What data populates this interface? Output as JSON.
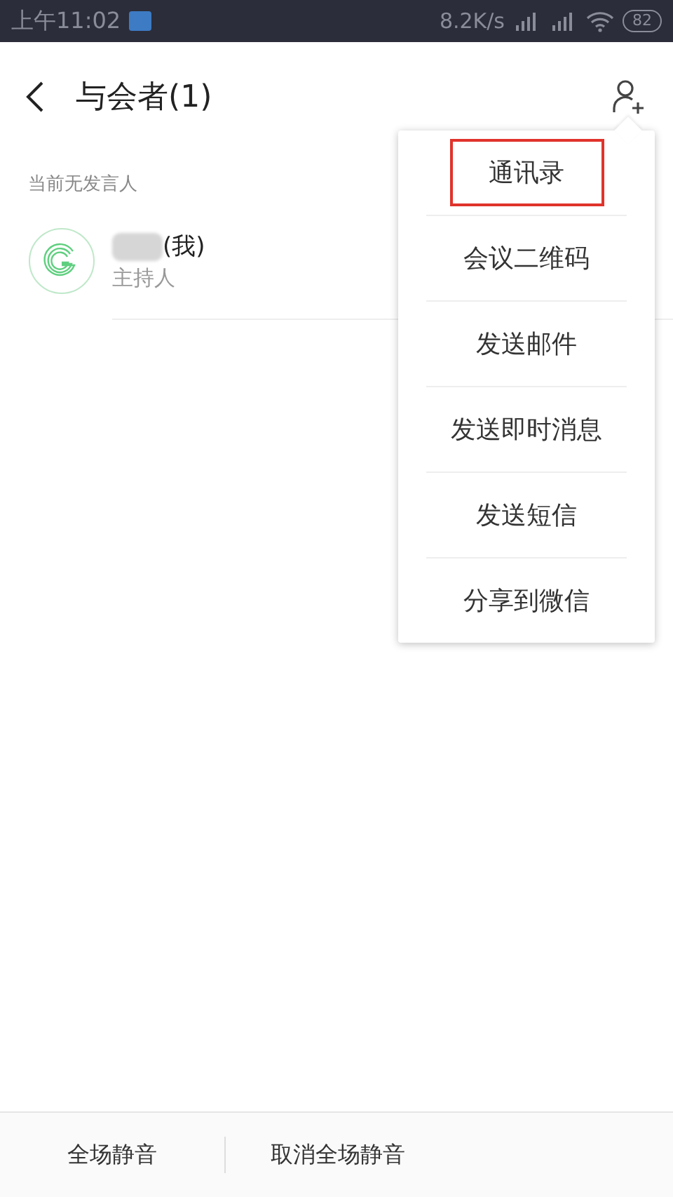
{
  "status_bar": {
    "time": "上午11:02",
    "speed": "8.2K/s",
    "battery": "82"
  },
  "header": {
    "title": "与会者(1)"
  },
  "speaker_note": "当前无发言人",
  "participants": [
    {
      "name": "(我)",
      "role": "主持人"
    }
  ],
  "menu": {
    "items": [
      {
        "label": "通讯录",
        "highlighted": true
      },
      {
        "label": "会议二维码",
        "highlighted": false
      },
      {
        "label": "发送邮件",
        "highlighted": false
      },
      {
        "label": "发送即时消息",
        "highlighted": false
      },
      {
        "label": "发送短信",
        "highlighted": false
      },
      {
        "label": "分享到微信",
        "highlighted": false
      }
    ]
  },
  "bottom_bar": [
    "全场静音",
    "取消全场静音"
  ]
}
